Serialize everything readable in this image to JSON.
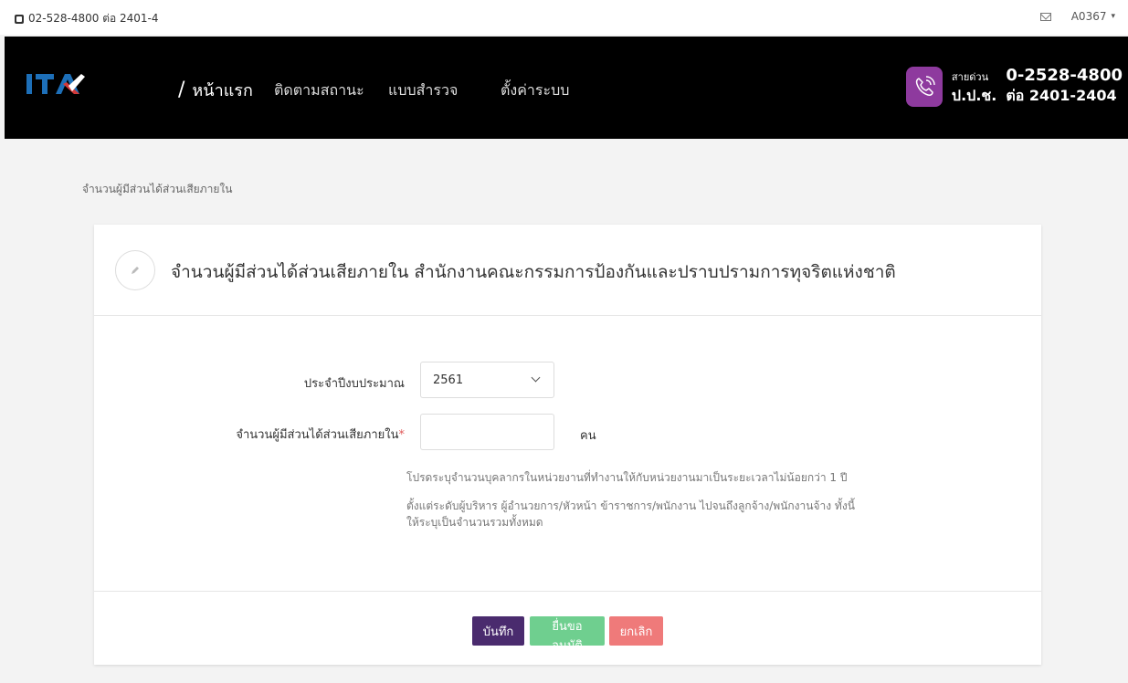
{
  "topbar": {
    "phone": "02-528-4800 ต่อ 2401-4",
    "user": "A0367"
  },
  "nav": {
    "items": [
      {
        "label": "หน้าแรก"
      },
      {
        "label": "ติดตามสถานะ"
      },
      {
        "label": "แบบสำรวจ"
      },
      {
        "label": "ตั้งค่าระบบ"
      }
    ],
    "hotline": {
      "line1_small": "สายด่วน",
      "line1_big": "0-2528-4800",
      "line2_small": "ป.ป.ช.",
      "line2_big": "ต่อ 2401-2404"
    }
  },
  "breadcrumb": "จำนวนผู้มีส่วนได้ส่วนเสียภายใน",
  "card": {
    "title": "จำนวนผู้มีส่วนได้ส่วนเสียภายใน สำนักงานคณะกรรมการป้องกันและปราบปรามการทุจริตแห่งชาติ"
  },
  "form": {
    "year_label": "ประจำปีงบประมาณ",
    "year_value": "2561",
    "count_label": "จำนวนผู้มีส่วนได้ส่วนเสียภายใน",
    "required_mark": "*",
    "count_value": "",
    "unit": "คน",
    "help1": "โปรดระบุจำนวนบุคลากรในหน่วยงานที่ทำงานให้กับหน่วยงานมาเป็นระยะเวลาไม่น้อยกว่า 1 ปี",
    "help2": "ตั้งแต่ระดับผู้บริหาร ผู้อำนวยการ/หัวหน้า ข้าราชการ/พนักงาน ไปจนถึงลูกจ้าง/พนักงานจ้าง ทั้งนี้",
    "help3": "ให้ระบุเป็นจำนวนรวมทั้งหมด"
  },
  "buttons": {
    "save": "บันทึก",
    "submit": "ยื่นขออนุมัติ",
    "cancel": "ยกเลิก"
  },
  "colors": {
    "navbar": "#000000",
    "hotline_badge": "#8e3a9e",
    "save": "#4a2b6e",
    "submit": "#6fcf8f",
    "cancel": "#ef7a7a"
  }
}
